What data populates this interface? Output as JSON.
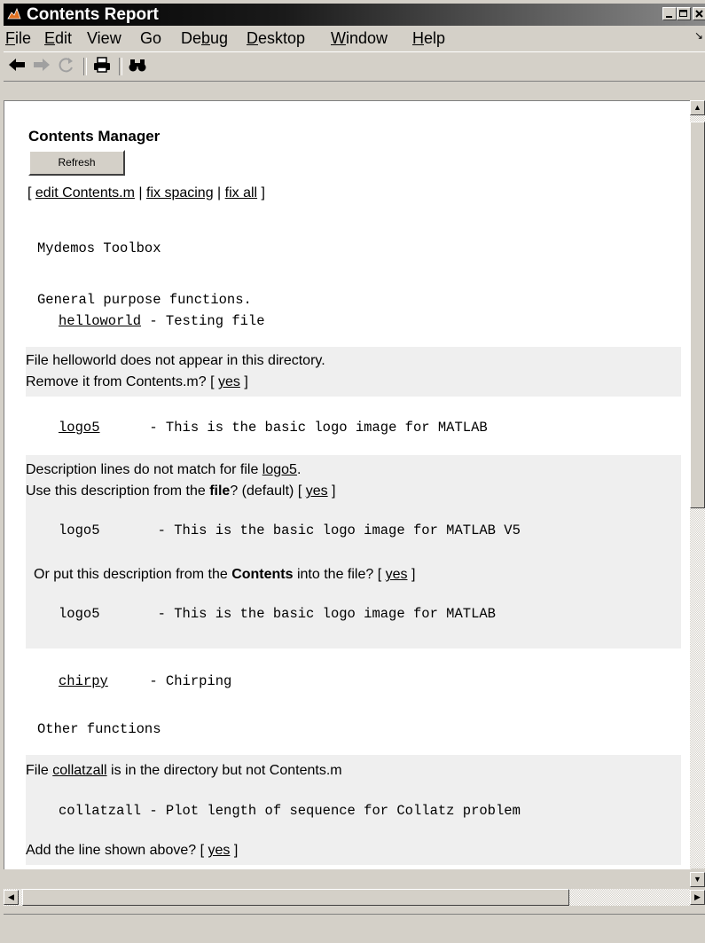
{
  "window": {
    "title": "Contents Report",
    "icon": "matlab-logo-icon"
  },
  "menu": [
    {
      "pre": "",
      "key": "F",
      "post": "ile"
    },
    {
      "pre": "",
      "key": "E",
      "post": "dit"
    },
    {
      "pre": "View",
      "key": "",
      "post": ""
    },
    {
      "pre": "Go",
      "key": "",
      "post": ""
    },
    {
      "pre": "De",
      "key": "b",
      "post": "ug"
    },
    {
      "pre": "",
      "key": "D",
      "post": "esktop"
    },
    {
      "pre": "",
      "key": "W",
      "post": "indow"
    },
    {
      "pre": "",
      "key": "H",
      "post": "elp"
    }
  ],
  "menu_extra": "↘",
  "toolbar": {
    "back_glyph": "🡐",
    "forward_glyph": "🡒",
    "refresh_glyph": "↻",
    "print_glyph": "🖶",
    "find_glyph": "⚲"
  },
  "content": {
    "heading": "Contents Manager",
    "refresh_label": "Refresh",
    "actions": {
      "open": "[ ",
      "edit": "edit Contents.m",
      "sep1": " | ",
      "spacing": "fix spacing",
      "sep2": " | ",
      "all": "fix all",
      "close": " ]"
    },
    "toolbox_title": "Mydemos Toolbox",
    "general_heading": "General purpose functions.",
    "helloworld": {
      "name": "helloworld",
      "desc": " - Testing file",
      "msg1": "File helloworld does not appear in this directory.",
      "msg2_pre": "Remove it from Contents.m? [ ",
      "yes": "yes",
      "msg2_post": " ]"
    },
    "logo5": {
      "name": "logo5",
      "desc": "      - This is the basic logo image for MATLAB",
      "msg1_pre": "Description lines do not match for file ",
      "msg1_link": "logo5",
      "msg1_post": ".",
      "msg2_pre": "Use this description from the ",
      "msg2_bold": "file",
      "msg2_post": "? (default) [ ",
      "yes1": "yes",
      "close1": " ]",
      "file_line": "logo5       - This is the basic logo image for MATLAB V5",
      "msg3_pre": "Or put this description from the ",
      "msg3_bold": "Contents",
      "msg3_post": " into the file? [ ",
      "yes2": "yes",
      "close2": " ]",
      "contents_line": "logo5       - This is the basic logo image for MATLAB"
    },
    "chirpy": {
      "name": "chirpy",
      "desc": "     - Chirping"
    },
    "other_heading": "Other functions",
    "collatzall": {
      "msg1_pre": "File ",
      "msg1_link": "collatzall",
      "msg1_post": " is in the directory but not Contents.m",
      "line": "collatzall - Plot length of sequence for Collatz problem",
      "msg2_pre": "Add the line shown above? [ ",
      "yes": "yes",
      "msg2_post": " ]"
    }
  },
  "scrollbars": {
    "up": "▲",
    "down": "▼",
    "left": "◀",
    "right": "▶"
  }
}
